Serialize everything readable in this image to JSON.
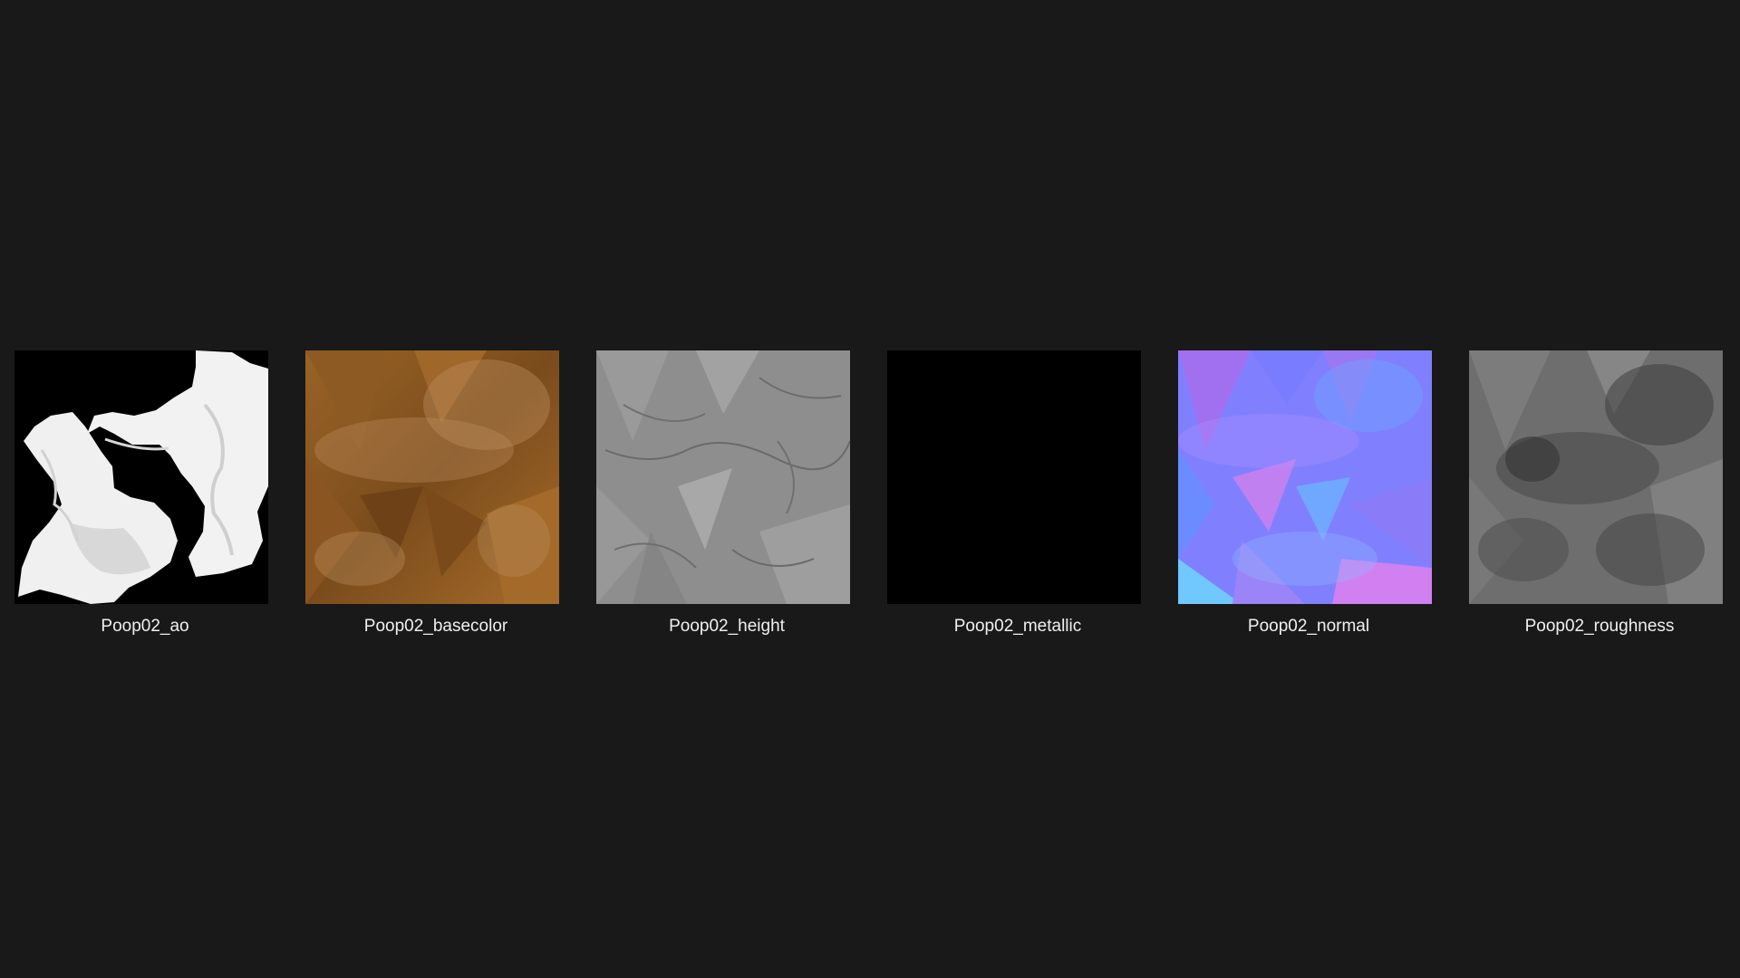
{
  "files": [
    {
      "name": "Poop02_ao",
      "thumbnail": "ambient-occlusion-map-thumbnail",
      "colors": {
        "bg": "#000000",
        "fg": "#f4f4f4",
        "shade": "#d8d8d8"
      }
    },
    {
      "name": "Poop02_basecolor",
      "thumbnail": "basecolor-map-thumbnail",
      "colors": {
        "base": "#8a5a22",
        "dark": "#6e4316",
        "light": "#b0742e",
        "pale": "#c9a070"
      }
    },
    {
      "name": "Poop02_height",
      "thumbnail": "height-map-thumbnail",
      "colors": {
        "base": "#8e8e8e",
        "dark": "#6a6a6a",
        "light": "#a6a6a6"
      }
    },
    {
      "name": "Poop02_metallic",
      "thumbnail": "metallic-map-thumbnail",
      "colors": {
        "base": "#000000"
      }
    },
    {
      "name": "Poop02_normal",
      "thumbnail": "normal-map-thumbnail",
      "colors": {
        "base": "#8080ff",
        "violet": "#a070f0",
        "blue": "#6a8cff",
        "cyan": "#70c8ff",
        "pink": "#d080f0"
      }
    },
    {
      "name": "Poop02_roughness",
      "thumbnail": "roughness-map-thumbnail",
      "colors": {
        "base": "#6e6e6e",
        "dark": "#3e3e3e",
        "light": "#8e8e8e"
      }
    }
  ]
}
